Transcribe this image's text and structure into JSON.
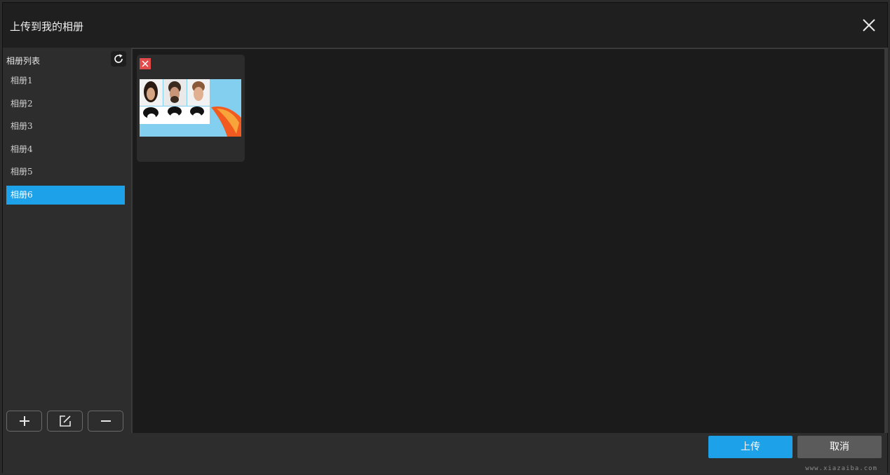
{
  "dialog": {
    "title": "上传到我的相册"
  },
  "sidebar": {
    "header": "相册列表",
    "items": [
      {
        "label": "相册1",
        "selected": false
      },
      {
        "label": "相册2",
        "selected": false
      },
      {
        "label": "相册3",
        "selected": false
      },
      {
        "label": "相册4",
        "selected": false
      },
      {
        "label": "相册5",
        "selected": false
      },
      {
        "label": "相册6",
        "selected": true
      }
    ],
    "tools": [
      "plus-icon",
      "edit-icon",
      "minus-icon"
    ]
  },
  "main": {
    "photos": [
      {
        "description_icon": "photo-thumbnail"
      }
    ]
  },
  "footer": {
    "upload_label": "上传",
    "cancel_label": "取消"
  },
  "watermark": "www.xiazaiba.com",
  "colors": {
    "accent": "#1da1e8",
    "delete": "#e34a4a",
    "panel": "#2d2d2d",
    "main": "#1b1b1b"
  }
}
